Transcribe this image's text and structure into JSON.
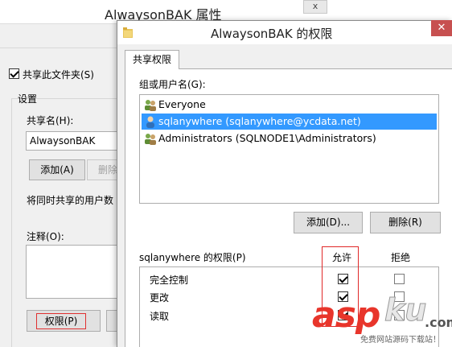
{
  "background_window": {
    "title": "AlwaysonBAK 属性",
    "close_label": "x",
    "share_folder_label": "共享此文件夹(S)",
    "share_folder_checked": true,
    "settings_label": "设置",
    "share_name_label": "共享名(H):",
    "share_name_value": "AlwaysonBAK",
    "add_label": "添加(A)",
    "remove_label": "删除",
    "concurrent_users_label": "将同时共享的用户数",
    "comment_label": "注释(O):",
    "permissions_label": "权限(P)"
  },
  "dialog": {
    "title": "AlwaysonBAK 的权限",
    "close_label": "✕",
    "tab_label": "共享权限",
    "group_label": "组或用户名(G):",
    "users": [
      {
        "name": "Everyone",
        "icon": "group-icon",
        "selected": false
      },
      {
        "name": "sqlanywhere (sqlanywhere@ycdata.net)",
        "icon": "user-icon",
        "selected": true
      },
      {
        "name": "Administrators (SQLNODE1\\Administrators)",
        "icon": "group-icon",
        "selected": false
      }
    ],
    "add_label": "添加(D)...",
    "remove_label": "删除(R)",
    "permissions_for_label": "sqlanywhere 的权限(P)",
    "allow_header": "允许",
    "deny_header": "拒绝",
    "permissions": [
      {
        "name": "完全控制",
        "allow": true,
        "deny": false
      },
      {
        "name": "更改",
        "allow": true,
        "deny": false
      },
      {
        "name": "读取",
        "allow": true,
        "deny": false
      }
    ]
  },
  "watermark": {
    "brand_a": "asp",
    "brand_b": "ku",
    "suffix": ".com",
    "tagline": "免费网站源码下载站！"
  },
  "colors": {
    "selection": "#3399ff",
    "highlight_box": "#e02828",
    "close_button": "#c75050",
    "watermark_red": "#e8352b"
  }
}
